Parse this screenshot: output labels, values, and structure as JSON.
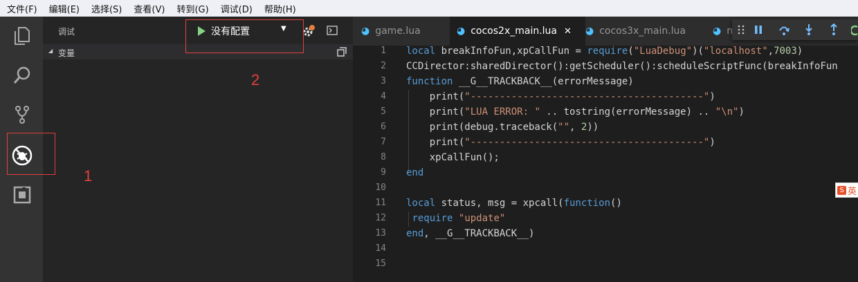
{
  "menu": [
    "文件(F)",
    "编辑(E)",
    "选择(S)",
    "查看(V)",
    "转到(G)",
    "调试(D)",
    "帮助(H)"
  ],
  "activity_bar": {
    "items": [
      "files-icon",
      "search-icon",
      "source-control-icon",
      "debug-icon",
      "extensions-icon"
    ],
    "active": "debug-icon"
  },
  "sidebar": {
    "title": "调试",
    "config_label": "没有配置",
    "section_label": "变量"
  },
  "annotations": {
    "marker_1": "1",
    "marker_2": "2",
    "color": "#e3413c"
  },
  "tabs": [
    {
      "label": "game.lua",
      "active": false
    },
    {
      "label": "cocos2x_main.lua",
      "active": true,
      "close": "✕"
    },
    {
      "label": "cocos3x_main.lua",
      "active": false
    },
    {
      "label": "n",
      "active": false
    }
  ],
  "editor": {
    "line_numbers": [
      "1",
      "2",
      "3",
      "4",
      "5",
      "6",
      "7",
      "8",
      "9",
      "10",
      "11",
      "12",
      "13",
      "14",
      "15"
    ],
    "lines": [
      "local breakInfoFun,xpCallFun = require(\"LuaDebug\")(\"localhost\",7003)",
      "CCDirector:sharedDirector():getScheduler():scheduleScriptFunc(breakInfoFun",
      "function __G__TRACKBACK__(errorMessage)",
      "    print(\"----------------------------------------\")",
      "    print(\"LUA ERROR: \" .. tostring(errorMessage) .. \"\\n\")",
      "    print(debug.traceback(\"\", 2))",
      "    print(\"----------------------------------------\")",
      "    xpCallFun();",
      "end",
      "",
      "local status, msg = xpcall(function()",
      " require \"update\"",
      "end, __G__TRACKBACK__)",
      "",
      ""
    ]
  },
  "ime_label": "英",
  "colors": {
    "keyword": "#569cd6",
    "string": "#ce9178",
    "number": "#b5cea8",
    "editor_bg": "#1e1e1e",
    "sidebar_bg": "#252526",
    "activity_bg": "#333333"
  }
}
